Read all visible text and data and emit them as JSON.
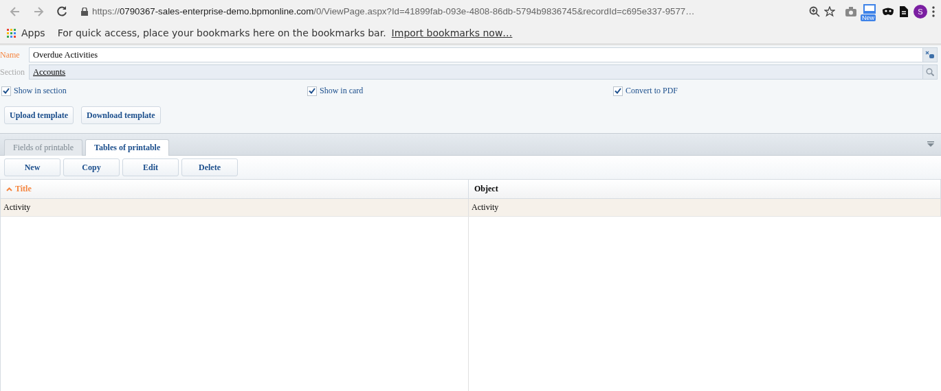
{
  "browser": {
    "url": {
      "scheme": "https://",
      "host": "0790367-sales-enterprise-demo.bpmonline.com",
      "path": "/0/ViewPage.aspx?Id=41899fab-093e-4808-86db-5794b9836745&recordId=c695e337-9577…"
    },
    "new_badge": "New",
    "avatar": "S"
  },
  "bookmarks": {
    "apps": "Apps",
    "message": "For quick access, place your bookmarks here on the bookmarks bar.",
    "link": "Import bookmarks now…"
  },
  "fields": [
    {
      "label": "Name",
      "value": "Overdue Activities",
      "kind": "text",
      "required": true
    },
    {
      "label": "Section",
      "value": "Accounts",
      "kind": "lookup",
      "required": false
    }
  ],
  "checkboxes": [
    {
      "label": "Show in section",
      "checked": true
    },
    {
      "label": "Show in card",
      "checked": true
    },
    {
      "label": "Convert to PDF",
      "checked": true
    }
  ],
  "buttons": [
    "Upload template",
    "Download template"
  ],
  "tabs": [
    {
      "label": "Fields of printable",
      "selected": false
    },
    {
      "label": "Tables of printable",
      "selected": true
    }
  ],
  "toolbar": [
    "New",
    "Copy",
    "Edit",
    "Delete"
  ],
  "table": {
    "columns": [
      {
        "title": "Title",
        "sorted": true
      },
      {
        "title": "Object",
        "sorted": false
      }
    ],
    "rows": [
      {
        "cells": [
          "Activity",
          "Activity"
        ],
        "selected": true
      }
    ]
  }
}
